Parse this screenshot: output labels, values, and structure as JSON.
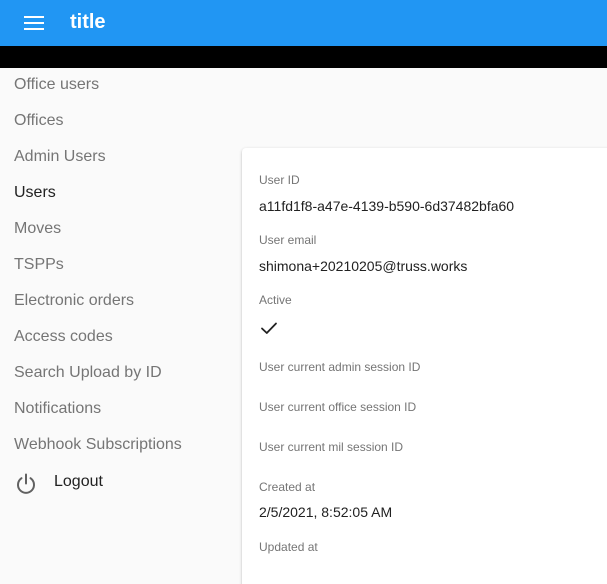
{
  "app": {
    "title": "title",
    "menu_icon": "menu-icon"
  },
  "sidebar": {
    "items": [
      {
        "label": "Office users",
        "active": false
      },
      {
        "label": "Offices",
        "active": false
      },
      {
        "label": "Admin Users",
        "active": false
      },
      {
        "label": "Users",
        "active": true
      },
      {
        "label": "Moves",
        "active": false
      },
      {
        "label": "TSPPs",
        "active": false
      },
      {
        "label": "Electronic orders",
        "active": false
      },
      {
        "label": "Access codes",
        "active": false
      },
      {
        "label": "Search Upload by ID",
        "active": false
      },
      {
        "label": "Notifications",
        "active": false
      },
      {
        "label": "Webhook Subscriptions",
        "active": false
      }
    ],
    "logout": {
      "label": "Logout",
      "icon": "power-icon"
    }
  },
  "record": {
    "user_id": {
      "label": "User ID",
      "value": "a11fd1f8-a47e-4139-b590-6d37482bfa60"
    },
    "user_email": {
      "label": "User email",
      "value": "shimona+20210205@truss.works"
    },
    "active": {
      "label": "Active",
      "value": true,
      "icon": "check-icon"
    },
    "admin_session": {
      "label": "User current admin session ID",
      "value": ""
    },
    "office_session": {
      "label": "User current office session ID",
      "value": ""
    },
    "mil_session": {
      "label": "User current mil session ID",
      "value": ""
    },
    "created_at": {
      "label": "Created at",
      "value": "2/5/2021, 8:52:05 AM"
    },
    "updated_at": {
      "label": "Updated at",
      "value": ""
    }
  },
  "colors": {
    "appbar": "#2196f3",
    "band": "#000000",
    "background": "#fafafa",
    "card": "#ffffff"
  }
}
